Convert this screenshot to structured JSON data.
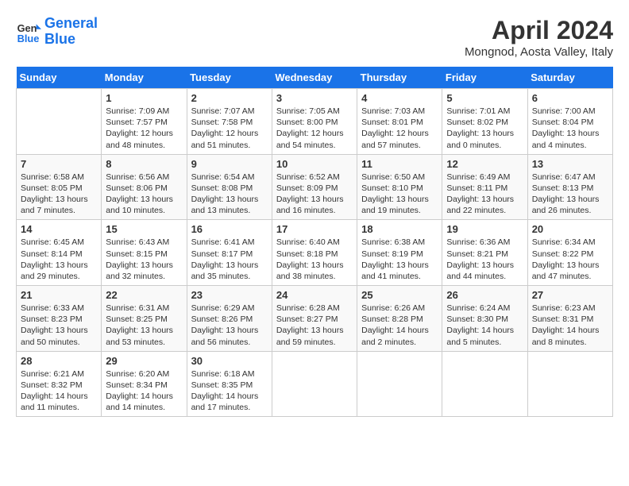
{
  "header": {
    "logo_line1": "General",
    "logo_line2": "Blue",
    "title": "April 2024",
    "location": "Mongnod, Aosta Valley, Italy"
  },
  "days_of_week": [
    "Sunday",
    "Monday",
    "Tuesday",
    "Wednesday",
    "Thursday",
    "Friday",
    "Saturday"
  ],
  "weeks": [
    [
      {
        "day": "",
        "info": ""
      },
      {
        "day": "1",
        "info": "Sunrise: 7:09 AM\nSunset: 7:57 PM\nDaylight: 12 hours\nand 48 minutes."
      },
      {
        "day": "2",
        "info": "Sunrise: 7:07 AM\nSunset: 7:58 PM\nDaylight: 12 hours\nand 51 minutes."
      },
      {
        "day": "3",
        "info": "Sunrise: 7:05 AM\nSunset: 8:00 PM\nDaylight: 12 hours\nand 54 minutes."
      },
      {
        "day": "4",
        "info": "Sunrise: 7:03 AM\nSunset: 8:01 PM\nDaylight: 12 hours\nand 57 minutes."
      },
      {
        "day": "5",
        "info": "Sunrise: 7:01 AM\nSunset: 8:02 PM\nDaylight: 13 hours\nand 0 minutes."
      },
      {
        "day": "6",
        "info": "Sunrise: 7:00 AM\nSunset: 8:04 PM\nDaylight: 13 hours\nand 4 minutes."
      }
    ],
    [
      {
        "day": "7",
        "info": "Sunrise: 6:58 AM\nSunset: 8:05 PM\nDaylight: 13 hours\nand 7 minutes."
      },
      {
        "day": "8",
        "info": "Sunrise: 6:56 AM\nSunset: 8:06 PM\nDaylight: 13 hours\nand 10 minutes."
      },
      {
        "day": "9",
        "info": "Sunrise: 6:54 AM\nSunset: 8:08 PM\nDaylight: 13 hours\nand 13 minutes."
      },
      {
        "day": "10",
        "info": "Sunrise: 6:52 AM\nSunset: 8:09 PM\nDaylight: 13 hours\nand 16 minutes."
      },
      {
        "day": "11",
        "info": "Sunrise: 6:50 AM\nSunset: 8:10 PM\nDaylight: 13 hours\nand 19 minutes."
      },
      {
        "day": "12",
        "info": "Sunrise: 6:49 AM\nSunset: 8:11 PM\nDaylight: 13 hours\nand 22 minutes."
      },
      {
        "day": "13",
        "info": "Sunrise: 6:47 AM\nSunset: 8:13 PM\nDaylight: 13 hours\nand 26 minutes."
      }
    ],
    [
      {
        "day": "14",
        "info": "Sunrise: 6:45 AM\nSunset: 8:14 PM\nDaylight: 13 hours\nand 29 minutes."
      },
      {
        "day": "15",
        "info": "Sunrise: 6:43 AM\nSunset: 8:15 PM\nDaylight: 13 hours\nand 32 minutes."
      },
      {
        "day": "16",
        "info": "Sunrise: 6:41 AM\nSunset: 8:17 PM\nDaylight: 13 hours\nand 35 minutes."
      },
      {
        "day": "17",
        "info": "Sunrise: 6:40 AM\nSunset: 8:18 PM\nDaylight: 13 hours\nand 38 minutes."
      },
      {
        "day": "18",
        "info": "Sunrise: 6:38 AM\nSunset: 8:19 PM\nDaylight: 13 hours\nand 41 minutes."
      },
      {
        "day": "19",
        "info": "Sunrise: 6:36 AM\nSunset: 8:21 PM\nDaylight: 13 hours\nand 44 minutes."
      },
      {
        "day": "20",
        "info": "Sunrise: 6:34 AM\nSunset: 8:22 PM\nDaylight: 13 hours\nand 47 minutes."
      }
    ],
    [
      {
        "day": "21",
        "info": "Sunrise: 6:33 AM\nSunset: 8:23 PM\nDaylight: 13 hours\nand 50 minutes."
      },
      {
        "day": "22",
        "info": "Sunrise: 6:31 AM\nSunset: 8:25 PM\nDaylight: 13 hours\nand 53 minutes."
      },
      {
        "day": "23",
        "info": "Sunrise: 6:29 AM\nSunset: 8:26 PM\nDaylight: 13 hours\nand 56 minutes."
      },
      {
        "day": "24",
        "info": "Sunrise: 6:28 AM\nSunset: 8:27 PM\nDaylight: 13 hours\nand 59 minutes."
      },
      {
        "day": "25",
        "info": "Sunrise: 6:26 AM\nSunset: 8:28 PM\nDaylight: 14 hours\nand 2 minutes."
      },
      {
        "day": "26",
        "info": "Sunrise: 6:24 AM\nSunset: 8:30 PM\nDaylight: 14 hours\nand 5 minutes."
      },
      {
        "day": "27",
        "info": "Sunrise: 6:23 AM\nSunset: 8:31 PM\nDaylight: 14 hours\nand 8 minutes."
      }
    ],
    [
      {
        "day": "28",
        "info": "Sunrise: 6:21 AM\nSunset: 8:32 PM\nDaylight: 14 hours\nand 11 minutes."
      },
      {
        "day": "29",
        "info": "Sunrise: 6:20 AM\nSunset: 8:34 PM\nDaylight: 14 hours\nand 14 minutes."
      },
      {
        "day": "30",
        "info": "Sunrise: 6:18 AM\nSunset: 8:35 PM\nDaylight: 14 hours\nand 17 minutes."
      },
      {
        "day": "",
        "info": ""
      },
      {
        "day": "",
        "info": ""
      },
      {
        "day": "",
        "info": ""
      },
      {
        "day": "",
        "info": ""
      }
    ]
  ]
}
